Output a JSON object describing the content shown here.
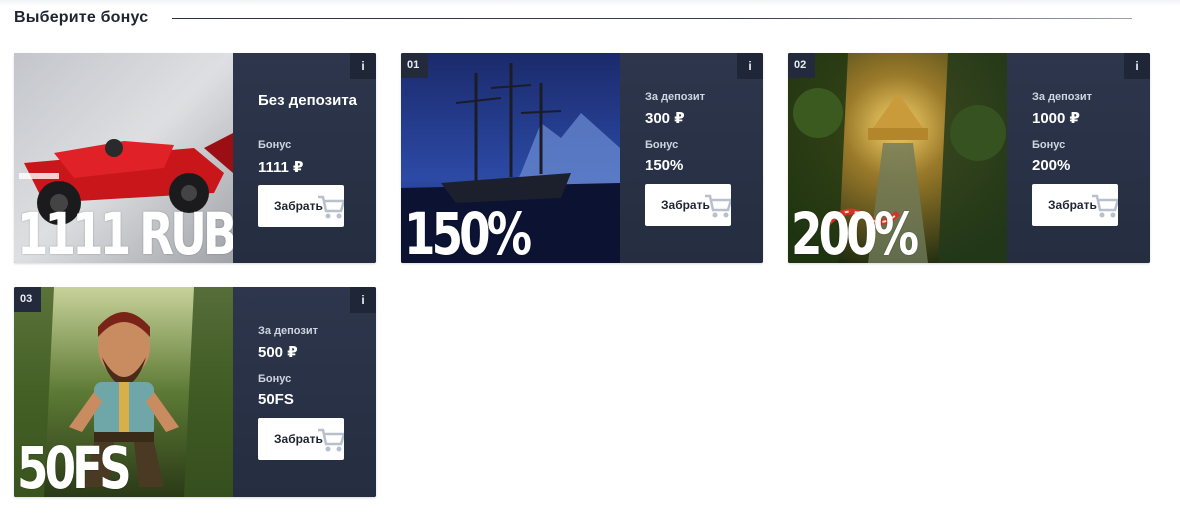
{
  "section": {
    "title": "Выберите бонус"
  },
  "cards": [
    {
      "number": "",
      "info": "i",
      "image_text": "1111 RUB",
      "title": "Без депозита",
      "bonus_label": "Бонус",
      "bonus_value": "1111 ₽",
      "button": "Забрать"
    },
    {
      "number": "01",
      "info": "i",
      "image_text": "150%",
      "deposit_label": "За депозит",
      "deposit_value": "300 ₽",
      "bonus_label": "Бонус",
      "bonus_value": "150%",
      "button": "Забрать"
    },
    {
      "number": "02",
      "info": "i",
      "image_text": "200%",
      "deposit_label": "За депозит",
      "deposit_value": "1000 ₽",
      "bonus_label": "Бонус",
      "bonus_value": "200%",
      "button": "Забрать"
    },
    {
      "number": "03",
      "info": "i",
      "image_text": "50FS",
      "deposit_label": "За депозит",
      "deposit_value": "500 ₽",
      "bonus_label": "Бонус",
      "bonus_value": "50FS",
      "button": "Забрать"
    }
  ],
  "icons": {
    "cart": "shopping-cart-icon"
  },
  "colors": {
    "panel": "#2a3247",
    "button": "#ffffff",
    "text_dark": "#1e2431"
  }
}
